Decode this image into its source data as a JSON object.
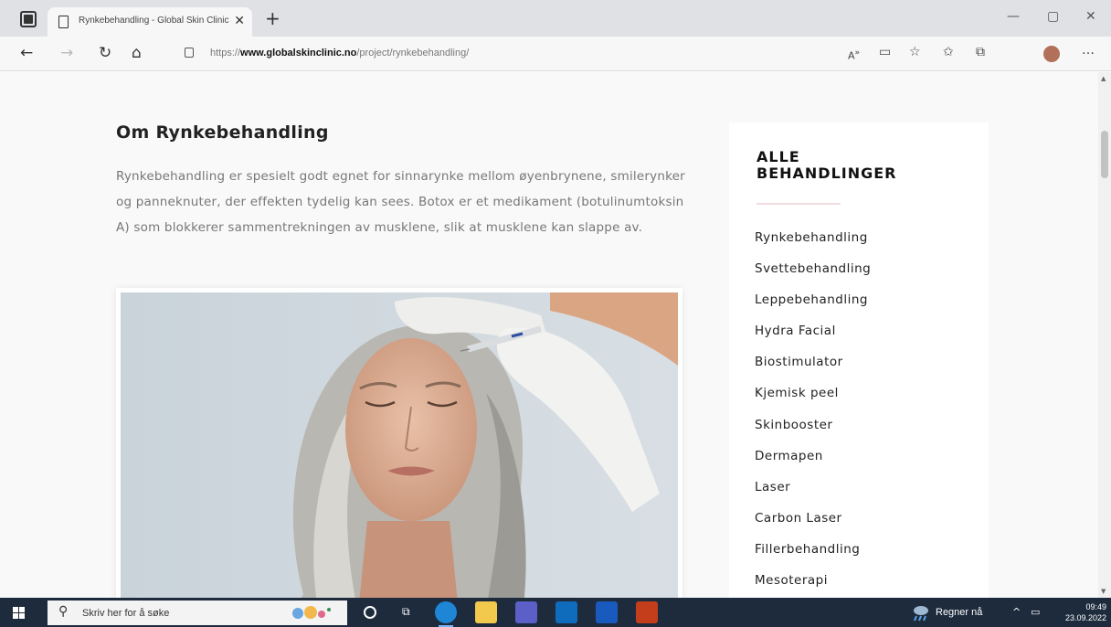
{
  "browser": {
    "tab_title": "Rynkebehandling - Global Skin Clinic",
    "tab_close": "✕",
    "new_tab": "+",
    "url_prefix": "https://",
    "url_host": "www.globalskinclinic.no",
    "url_path": "/project/rynkebehandling/",
    "icons": {
      "back": "arrow-left-icon",
      "forward": "arrow-right-icon",
      "refresh": "refresh-icon",
      "home": "home-icon",
      "read_aloud": "read-aloud-icon",
      "immersive_reader": "immersive-reader-icon",
      "add_favorite": "add-favorite-icon",
      "favorites": "favorites-icon",
      "collections": "collections-icon",
      "more": "more-icon"
    }
  },
  "content": {
    "title": "Om Rynkebehandling",
    "body": "Rynkebehandling er spesielt godt egnet for sinnarynke mellom øyenbrynene, smilerynker og panneknuter, der effekten tydelig kan sees. Botox er et medikament (botulinumtoksin A) som blokkerer sammentrekningen av musklene, slik at musklene kan slappe av."
  },
  "sidebar": {
    "heading": "ALLE BEHANDLINGER",
    "items": [
      "Rynkebehandling",
      "Svettebehandling",
      "Leppebehandling",
      "Hydra Facial",
      "Biostimulator",
      "Kjemisk peel",
      "Skinbooster",
      "Dermapen",
      "Laser",
      "Carbon Laser",
      "Fillerbehandling",
      "Mesoterapi"
    ]
  },
  "taskbar": {
    "search_placeholder": "Skriv her for å søke",
    "weather": "Regner nå",
    "time": "09:49",
    "date": "23.09.2022"
  },
  "colors": {
    "titlebar": "#dfe1e5",
    "toolbar": "#f7f7f7",
    "page_bg": "#f9f9f9",
    "sidebar_divider": "#f3dcdf",
    "taskbar": "#1e2b3d"
  }
}
